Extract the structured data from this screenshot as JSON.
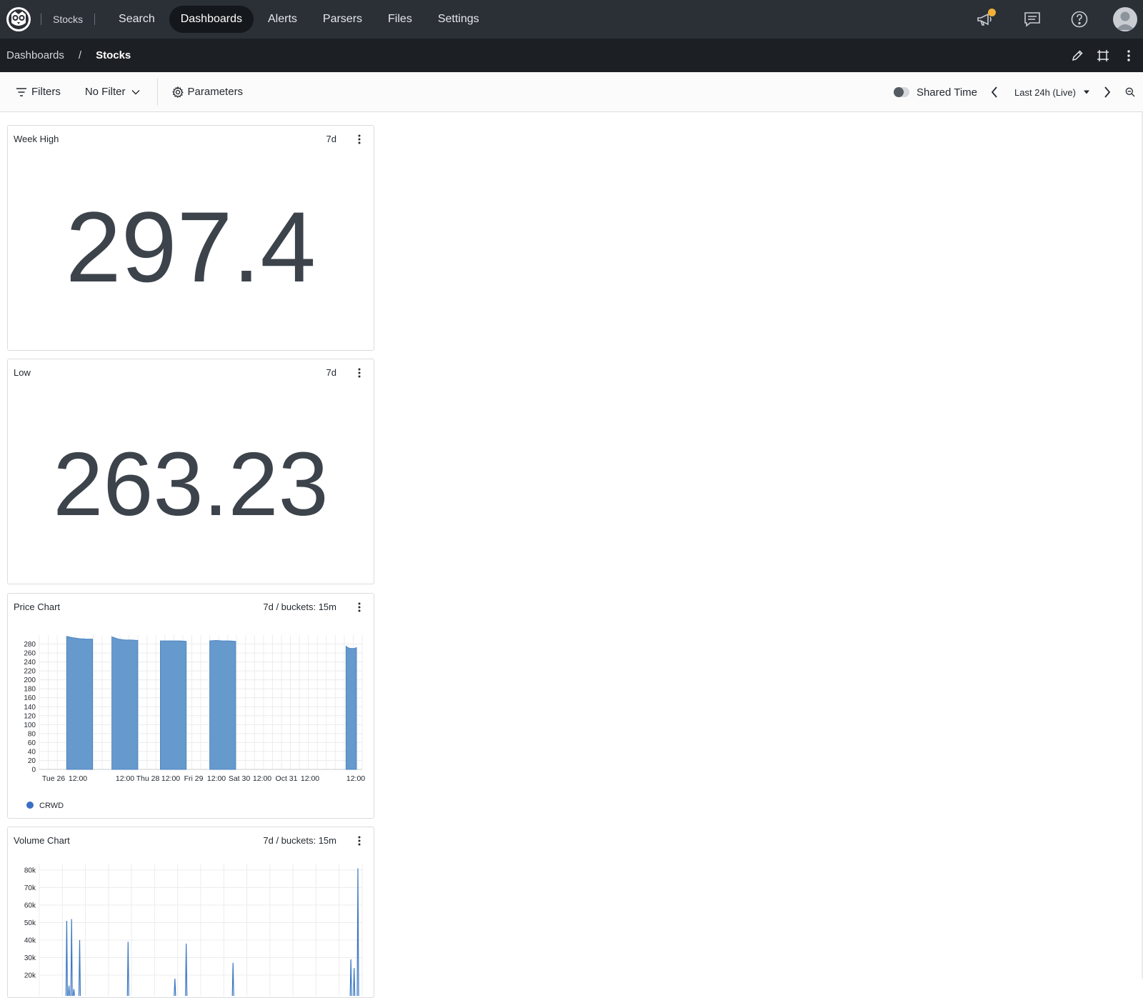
{
  "topnav": {
    "repo": "Stocks",
    "tabs": [
      {
        "label": "Search"
      },
      {
        "label": "Dashboards"
      },
      {
        "label": "Alerts"
      },
      {
        "label": "Parsers"
      },
      {
        "label": "Files"
      },
      {
        "label": "Settings"
      }
    ],
    "active_tab": "Dashboards",
    "notification_color": "#f2b136"
  },
  "breadcrumb": {
    "parent": "Dashboards",
    "separator": "/",
    "current": "Stocks"
  },
  "toolbar": {
    "filters_label": "Filters",
    "filter_select": "No Filter",
    "parameters_label": "Parameters",
    "shared_time_label": "Shared Time",
    "time_range": "Last 24h (Live)"
  },
  "widgets": [
    {
      "title": "Week High",
      "meta": "7d",
      "value": "297.4"
    },
    {
      "title": "Low",
      "meta": "7d",
      "value": "263.23"
    },
    {
      "title": "Price Chart",
      "meta": "7d / buckets: 15m"
    },
    {
      "title": "Volume Chart",
      "meta": "7d / buckets: 15m"
    }
  ],
  "chart_data": [
    {
      "type": "area",
      "title": "Price Chart",
      "yticks": [
        0,
        20,
        40,
        60,
        80,
        100,
        120,
        140,
        160,
        180,
        200,
        220,
        240,
        260,
        280
      ],
      "ylim": [
        0,
        300
      ],
      "xticks": [
        "Tue 26",
        "12:00",
        "12:00",
        "Thu 28",
        "12:00",
        "Fri 29",
        "12:00",
        "Sat 30",
        "12:00",
        "Oct 31",
        "12:00",
        "12:00"
      ],
      "grid": true,
      "legend_position": "bottom-left",
      "series": [
        {
          "name": "CRWD",
          "color": "#6699cc",
          "segments": [
            {
              "start": 0.085,
              "end": 0.165,
              "values": [
                297,
                294,
                292,
                291,
                291
              ]
            },
            {
              "start": 0.225,
              "end": 0.305,
              "values": [
                296,
                291,
                289,
                289,
                288
              ]
            },
            {
              "start": 0.375,
              "end": 0.455,
              "values": [
                287,
                287,
                287,
                287,
                286
              ]
            },
            {
              "start": 0.528,
              "end": 0.608,
              "values": [
                287,
                288,
                287,
                287,
                286
              ]
            },
            {
              "start": 0.95,
              "end": 1.03,
              "values": [
                275,
                271,
                270,
                270,
                272
              ]
            }
          ]
        }
      ]
    },
    {
      "type": "line",
      "title": "Volume Chart",
      "yticks": [
        "20k",
        "30k",
        "40k",
        "50k",
        "60k",
        "70k",
        "80k"
      ],
      "ylim": [
        0,
        82000
      ],
      "grid": true,
      "series": [
        {
          "color": "#3b78c2",
          "spikes": [
            {
              "x": 0.085,
              "v": 51000
            },
            {
              "x": 0.092,
              "v": 14000
            },
            {
              "x": 0.1,
              "v": 52000
            },
            {
              "x": 0.107,
              "v": 12000
            },
            {
              "x": 0.125,
              "v": 40000
            },
            {
              "x": 0.275,
              "v": 39000
            },
            {
              "x": 0.42,
              "v": 18000
            },
            {
              "x": 0.455,
              "v": 38000
            },
            {
              "x": 0.6,
              "v": 27000
            },
            {
              "x": 0.965,
              "v": 29000
            },
            {
              "x": 0.975,
              "v": 24000
            },
            {
              "x": 1.0,
              "v": 81000
            }
          ]
        }
      ]
    }
  ]
}
